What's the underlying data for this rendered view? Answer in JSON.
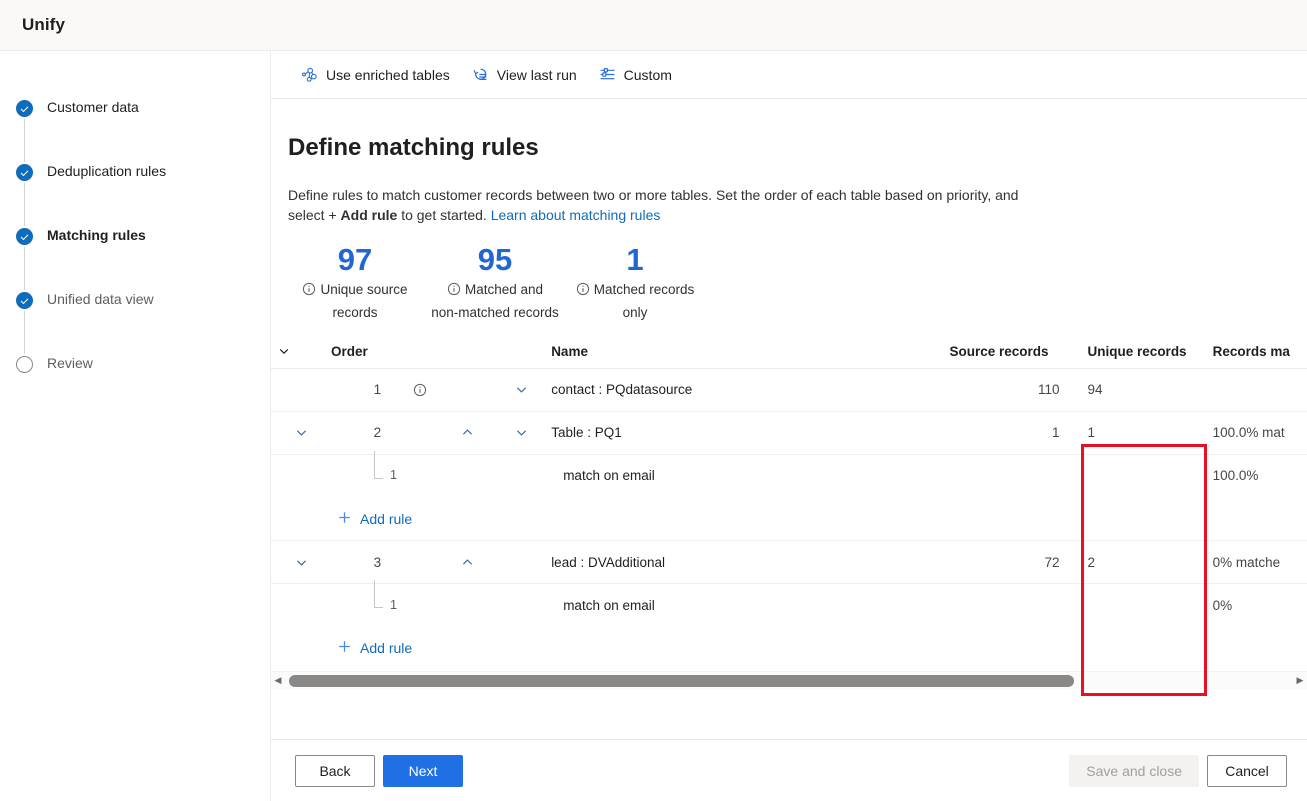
{
  "app": {
    "title": "Unify"
  },
  "wizard": {
    "steps": [
      {
        "label": "Customer data",
        "state": "done"
      },
      {
        "label": "Deduplication rules",
        "state": "done"
      },
      {
        "label": "Matching rules",
        "state": "current"
      },
      {
        "label": "Unified data view",
        "state": "done"
      },
      {
        "label": "Review",
        "state": "todo"
      }
    ]
  },
  "commandbar": {
    "items": [
      {
        "label": "Use enriched tables",
        "icon": "enriched-tables-icon"
      },
      {
        "label": "View last run",
        "icon": "history-icon"
      },
      {
        "label": "Custom",
        "icon": "settings-sliders-icon"
      }
    ]
  },
  "page": {
    "title": "Define matching rules",
    "description_part1": "Define rules to match customer records between two or more tables. Set the order of each table based on priority, and select + ",
    "description_bold": "Add rule",
    "description_part2": " to get started. ",
    "description_link": "Learn about matching rules"
  },
  "stats": [
    {
      "value": "97",
      "label_line1": "Unique source",
      "label_line2": "records",
      "icon": "info-icon"
    },
    {
      "value": "95",
      "label_line1": "Matched and",
      "label_line2": "non-matched records",
      "icon": "info-icon"
    },
    {
      "value": "1",
      "label_line1": "Matched records",
      "label_line2": "only",
      "icon": "info-icon"
    }
  ],
  "table": {
    "columns": [
      {
        "key": "expand",
        "label": ""
      },
      {
        "key": "order",
        "label": "Order"
      },
      {
        "key": "name",
        "label": "Name"
      },
      {
        "key": "source_records",
        "label": "Source records"
      },
      {
        "key": "unique_records",
        "label": "Unique records"
      },
      {
        "key": "records_matched",
        "label": "Records ma"
      }
    ],
    "header_chevron": "chevron-down-icon",
    "rows": [
      {
        "type": "table",
        "expand_chevron": "",
        "order": "1",
        "has_info": true,
        "move_up": "",
        "move_down": "chevron-down-icon",
        "name": "contact : PQdatasource",
        "source_records": "110",
        "unique_records": "94",
        "records_matched": ""
      },
      {
        "type": "table",
        "expand_chevron": "chevron-down-icon",
        "order": "2",
        "has_info": false,
        "move_up": "chevron-up-icon",
        "move_down": "chevron-down-icon",
        "name": "Table : PQ1",
        "source_records": "1",
        "unique_records": "1",
        "records_matched": "100.0% mat"
      },
      {
        "type": "rule",
        "index": "1",
        "name": "match on email",
        "source_records": "",
        "unique_records": "",
        "records_matched": "100.0%"
      },
      {
        "type": "add",
        "label": "Add rule",
        "icon": "plus-icon"
      },
      {
        "type": "table",
        "expand_chevron": "chevron-down-icon",
        "order": "3",
        "has_info": false,
        "move_up": "chevron-up-icon",
        "move_down": "",
        "name": "lead : DVAdditional",
        "source_records": "72",
        "unique_records": "2",
        "records_matched": "0% matche"
      },
      {
        "type": "rule",
        "index": "1",
        "name": "match on email",
        "source_records": "",
        "unique_records": "",
        "records_matched": "0%"
      },
      {
        "type": "add",
        "label": "Add rule",
        "icon": "plus-icon"
      }
    ]
  },
  "footer": {
    "back": "Back",
    "next": "Next",
    "save_and_close": "Save and close",
    "cancel": "Cancel"
  },
  "colors": {
    "accent": "#0f6cbd",
    "primary_button": "#1f6fe5",
    "stat_value": "#2266d3",
    "annotation": "#e81123"
  }
}
